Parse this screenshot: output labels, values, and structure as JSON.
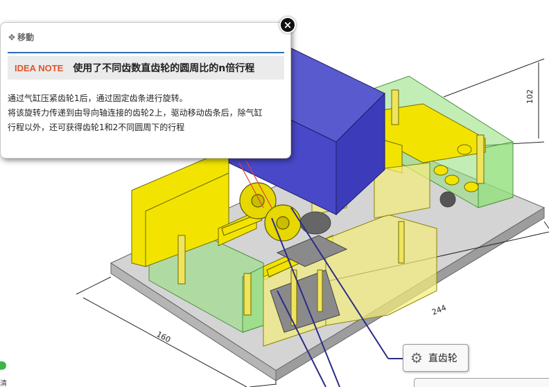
{
  "popup": {
    "move_label": "移動",
    "idea_tag": "IDEA NOTE",
    "title": "使用了不同齿数直齿轮的圆周比的n倍行程",
    "body_lines": [
      "通过气缸压紧齿轮1后，通过固定齿条进行旋转。",
      "将该旋转力传递到由导向轴连接的齿轮2上，驱动移动齿条后，除气缸",
      "行程以外，还可获得齿轮1和2不同圆周下的行程"
    ],
    "close_symbol": "×"
  },
  "dimensions": {
    "height": "102",
    "length": "244",
    "width": "160"
  },
  "part_label": {
    "icon": "gear-icon",
    "text": "直齿轮"
  },
  "side_char": "清",
  "colors": {
    "idea_tag": "#e0542a",
    "rule": "#2b6cb5",
    "status": "#3bb54a"
  }
}
